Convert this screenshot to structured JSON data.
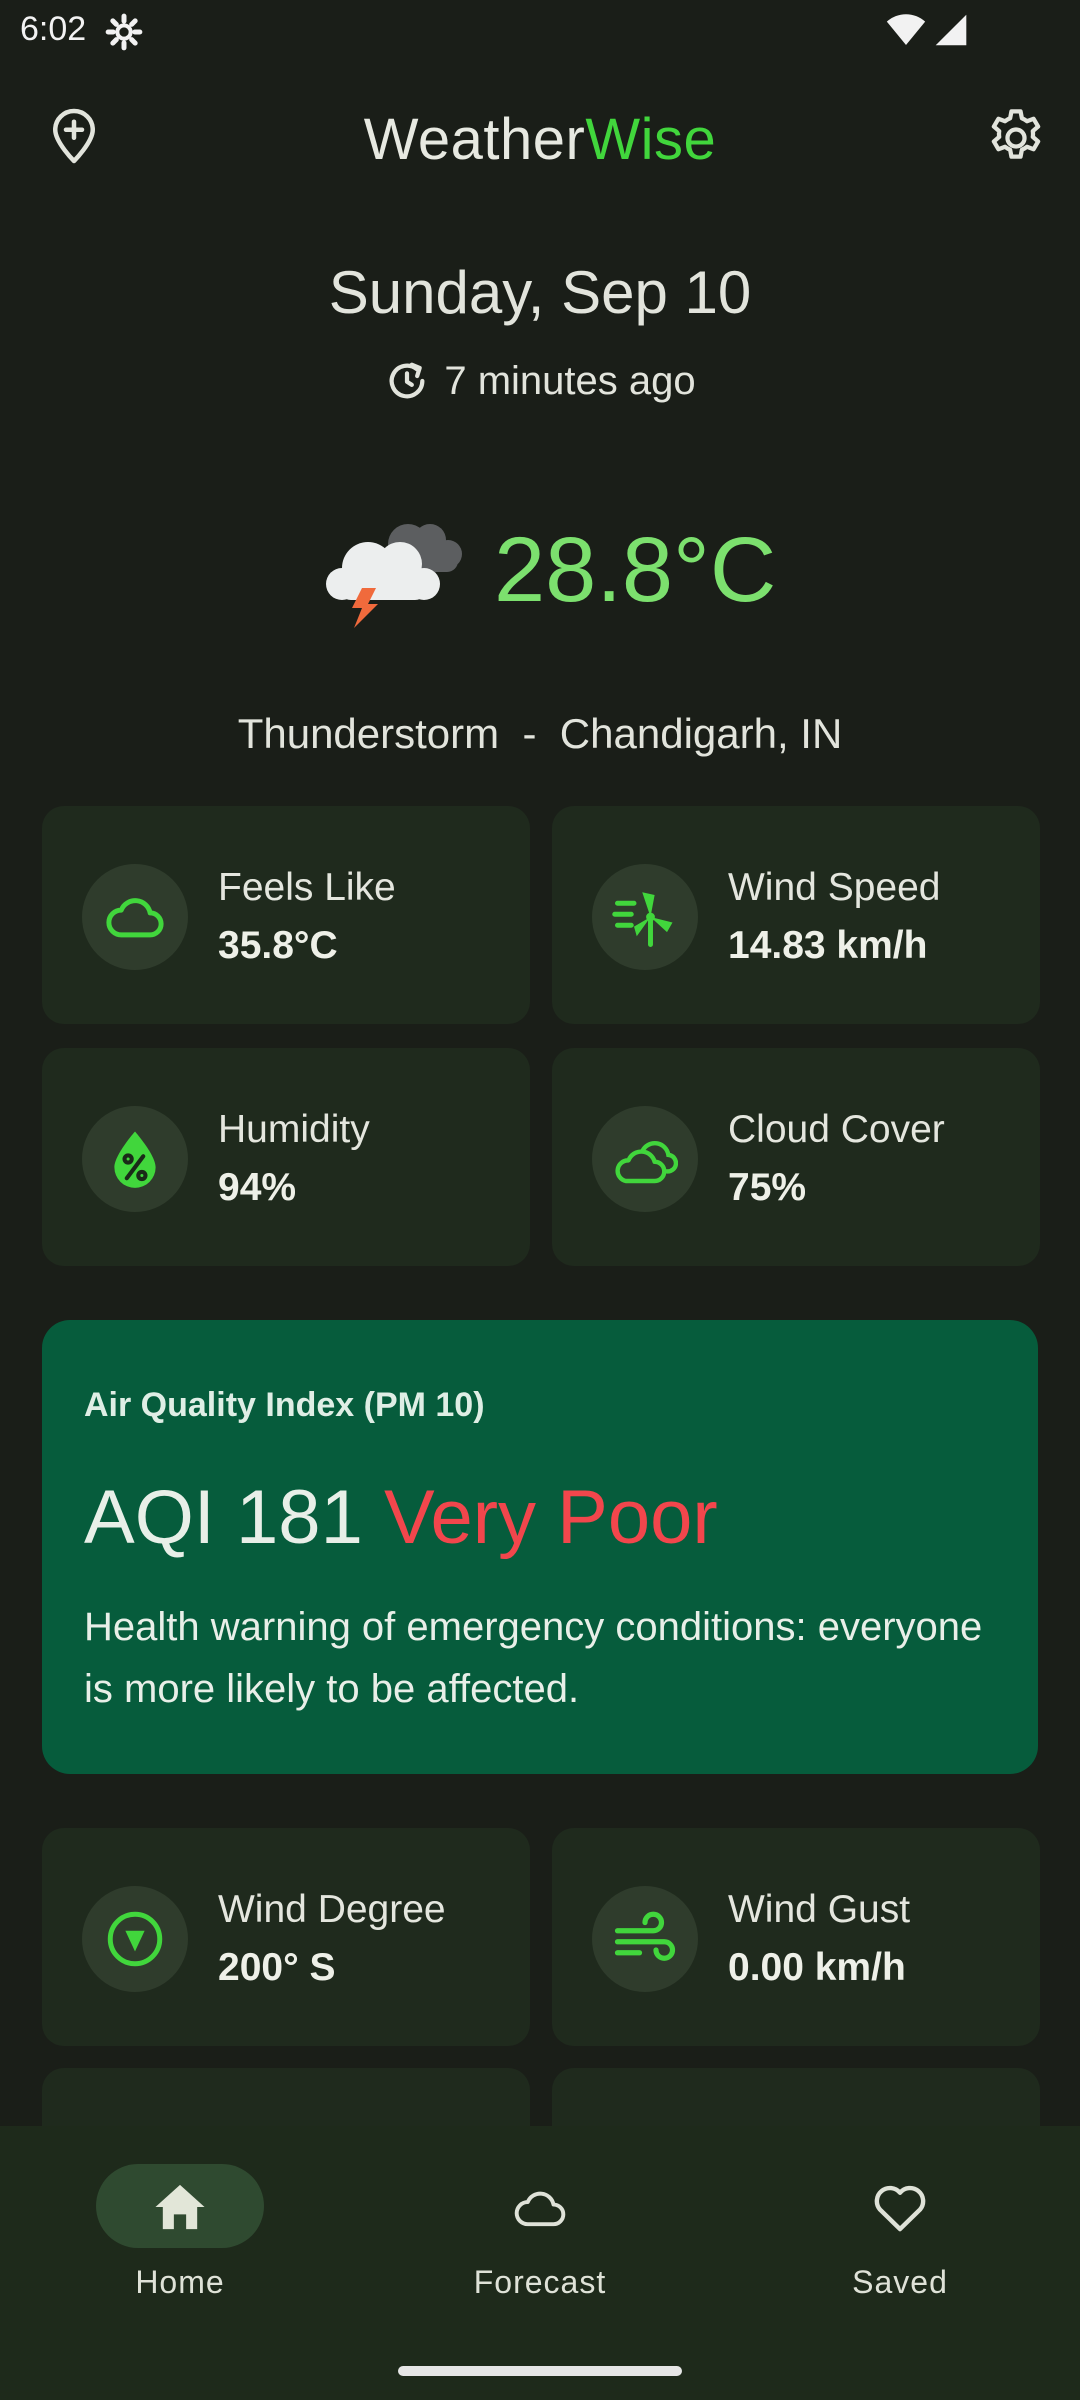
{
  "status_bar": {
    "time": "6:02"
  },
  "header": {
    "title_part1": "Weather",
    "title_part2": "Wise"
  },
  "current": {
    "date": "Sunday, Sep 10",
    "updated": "7 minutes ago",
    "temperature": "28.8°C",
    "condition_location": "Thunderstorm  -  Chandigarh, IN",
    "icon": "thunderstorm-cloud-icon"
  },
  "metrics": [
    {
      "label": "Feels Like",
      "value": "35.8°C",
      "icon": "cloud-icon"
    },
    {
      "label": "Wind Speed",
      "value": "14.83 km/h",
      "icon": "wind-turbine-icon"
    },
    {
      "label": "Humidity",
      "value": "94%",
      "icon": "humidity-drop-icon"
    },
    {
      "label": "Cloud Cover",
      "value": "75%",
      "icon": "clouds-icon"
    },
    {
      "label": "Wind Degree",
      "value": "200° S",
      "icon": "compass-icon"
    },
    {
      "label": "Wind Gust",
      "value": "0.00 km/h",
      "icon": "wind-gust-icon"
    }
  ],
  "aqi": {
    "title": "Air Quality Index (PM 10)",
    "value_text": "AQI 181",
    "level": "Very Poor",
    "description": "Health warning of emergency conditions: everyone is more likely to be affected."
  },
  "nav": {
    "items": [
      {
        "label": "Home",
        "icon": "home-icon",
        "active": true
      },
      {
        "label": "Forecast",
        "icon": "cloud-icon",
        "active": false
      },
      {
        "label": "Saved",
        "icon": "heart-icon",
        "active": false
      }
    ]
  },
  "colors": {
    "background": "#1a1e18",
    "accent_green": "#41d63c",
    "temperature": "#7ce06e",
    "card": "#1f2a1d",
    "aqi_card": "#065c3c",
    "aqi_level": "#f2464c"
  }
}
